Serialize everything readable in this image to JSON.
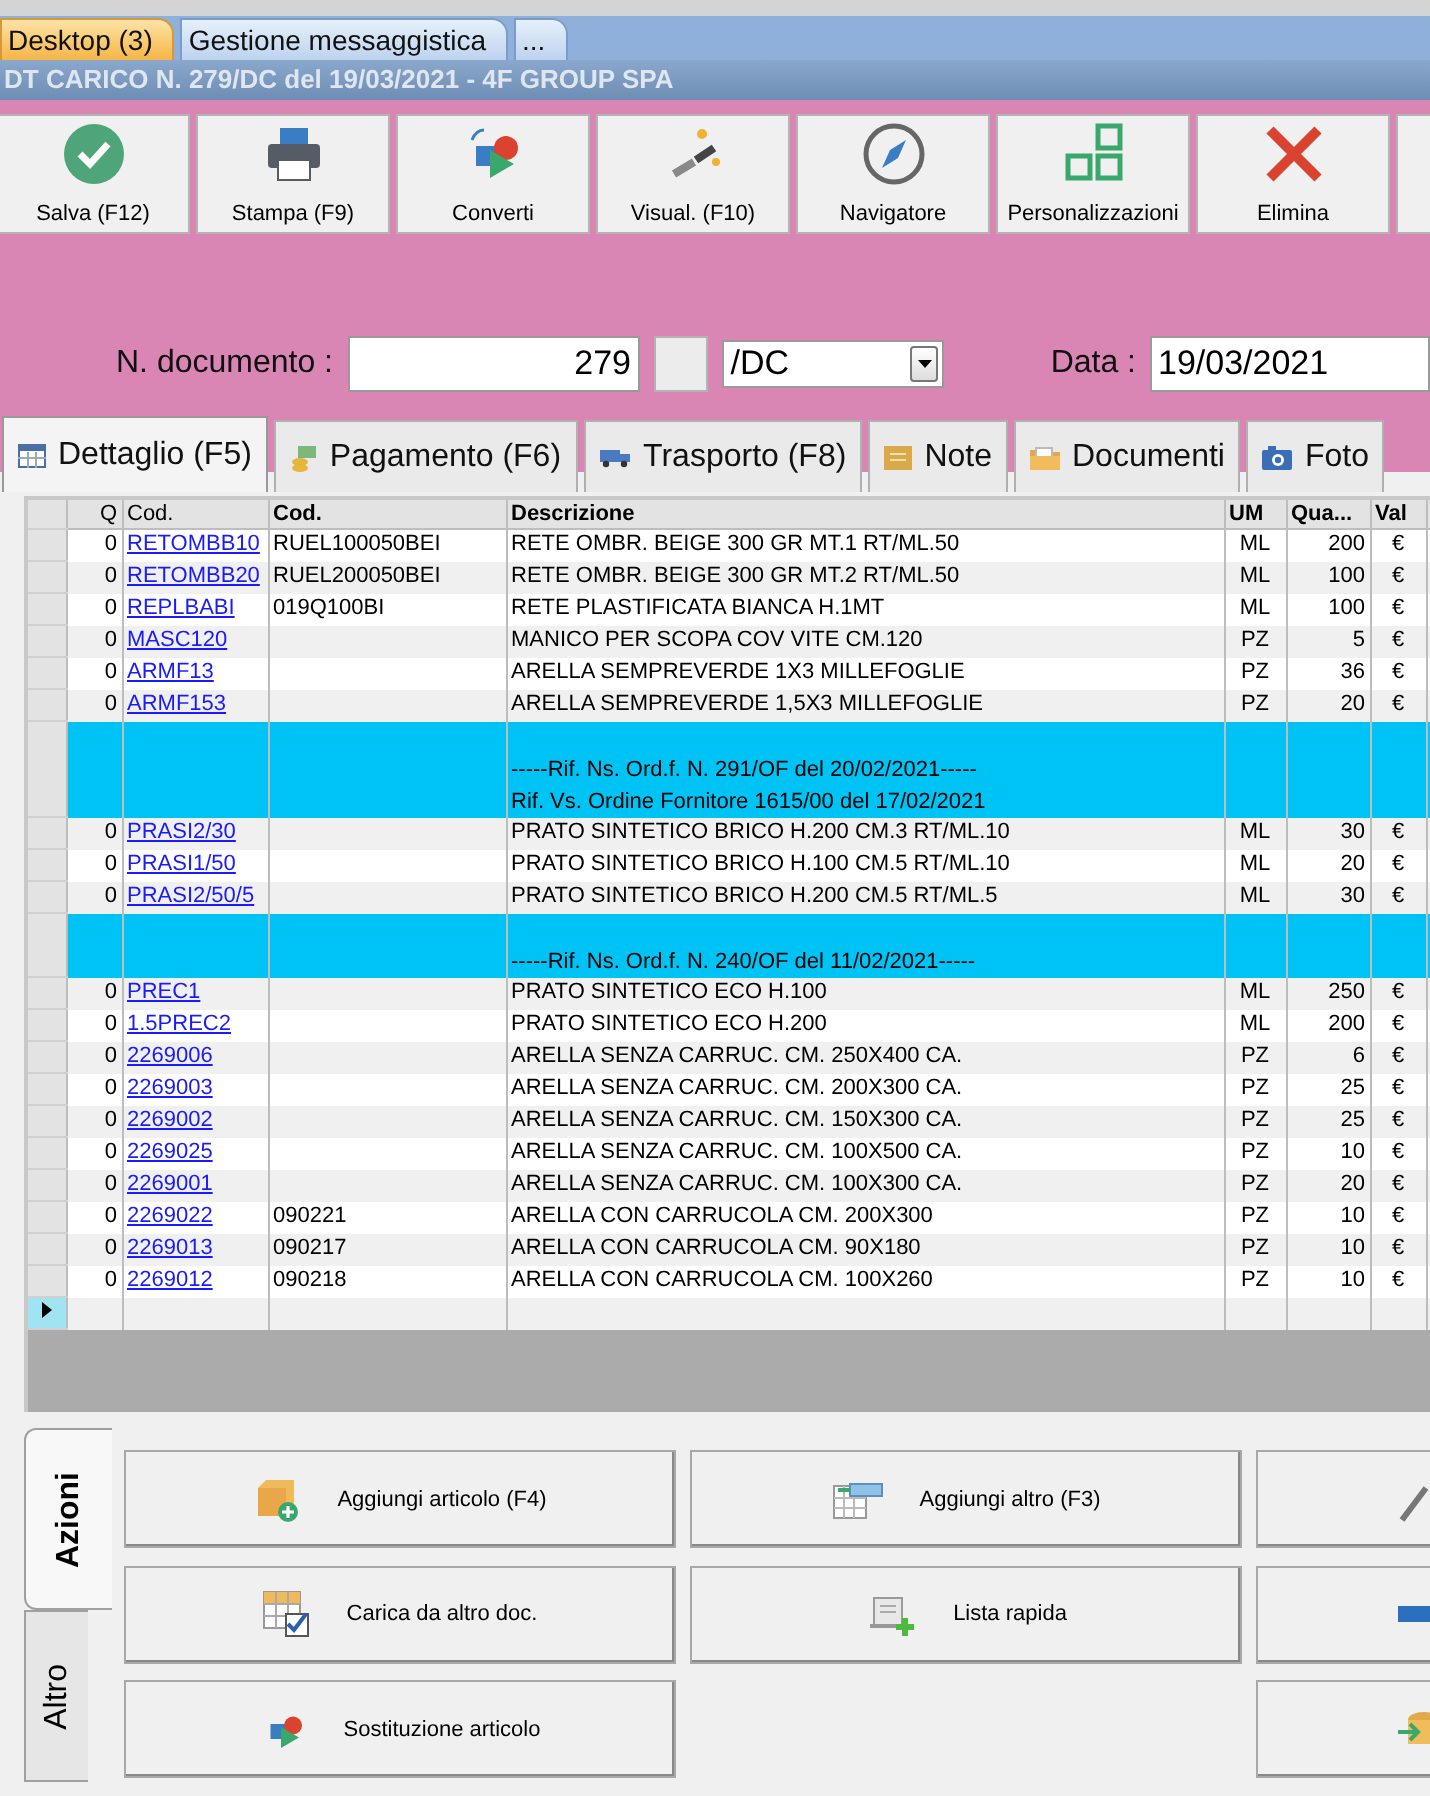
{
  "top_tabs": [
    {
      "label": "Desktop (3)",
      "selected": true
    },
    {
      "label": "Gestione messaggistica",
      "selected": false
    },
    {
      "label": "...",
      "selected": false
    }
  ],
  "document_title": "DT CARICO N. 279/DC del 19/03/2021 - 4F GROUP SPA",
  "toolbar": [
    {
      "label": "Salva (F12)"
    },
    {
      "label": "Stampa (F9)"
    },
    {
      "label": "Converti"
    },
    {
      "label": "Visual. (F10)"
    },
    {
      "label": "Navigatore"
    },
    {
      "label": "Personalizzazioni"
    },
    {
      "label": "Elimina"
    }
  ],
  "form": {
    "doc_label": "N. documento :",
    "doc_number": "279",
    "series": "/DC",
    "date_label": "Data :",
    "date": "19/03/2021"
  },
  "tabs": [
    {
      "label": "Dettaglio (F5)",
      "selected": true
    },
    {
      "label": "Pagamento (F6)",
      "selected": false
    },
    {
      "label": "Trasporto (F8)",
      "selected": false
    },
    {
      "label": "Note",
      "selected": false
    },
    {
      "label": "Documenti",
      "selected": false
    },
    {
      "label": "Foto",
      "selected": false
    }
  ],
  "table": {
    "columns": [
      "Q",
      "Cod.",
      "Cod.",
      "Descrizione",
      "UM",
      "Qua...",
      "Val"
    ],
    "rows": [
      {
        "kind": "item",
        "q": "0",
        "code": "RETOMBB10",
        "supplier_code": "RUEL100050BEI",
        "description": "RETE OMBR. BEIGE 300 GR MT.1 RT/ML.50",
        "um": "ML",
        "quantity": "200",
        "currency": "€"
      },
      {
        "kind": "item",
        "q": "0",
        "code": "RETOMBB20",
        "supplier_code": "RUEL200050BEI",
        "description": "RETE OMBR. BEIGE 300 GR MT.2 RT/ML.50",
        "um": "ML",
        "quantity": "100",
        "currency": "€"
      },
      {
        "kind": "item",
        "q": "0",
        "code": "REPLBABI",
        "supplier_code": "019Q100BI",
        "description": "RETE PLASTIFICATA BIANCA H.1MT",
        "um": "ML",
        "quantity": "100",
        "currency": "€"
      },
      {
        "kind": "item",
        "q": "0",
        "code": "MASC120",
        "description": "MANICO PER SCOPA COV VITE CM.120",
        "um": "PZ",
        "quantity": "5",
        "currency": "€"
      },
      {
        "kind": "item",
        "q": "0",
        "code": "ARMF13",
        "description": "ARELLA SEMPREVERDE 1X3 MILLEFOGLIE",
        "um": "PZ",
        "quantity": "36",
        "currency": "€"
      },
      {
        "kind": "item",
        "q": "0",
        "code": "ARMF153",
        "description": "ARELLA SEMPREVERDE 1,5X3 MILLEFOGLIE",
        "um": "PZ",
        "quantity": "20",
        "currency": "€"
      },
      {
        "kind": "ref",
        "lines": [
          "-----Rif. Ns. Ord.f. N. 291/OF del 20/02/2021-----",
          "Rif. Vs. Ordine Fornitore  1615/00 del 17/02/2021"
        ]
      },
      {
        "kind": "item",
        "q": "0",
        "code": "PRASI2/30",
        "description": "PRATO SINTETICO BRICO H.200 CM.3 RT/ML.10",
        "um": "ML",
        "quantity": "30",
        "currency": "€"
      },
      {
        "kind": "item",
        "q": "0",
        "code": "PRASI1/50",
        "description": "PRATO SINTETICO BRICO H.100 CM.5 RT/ML.10",
        "um": "ML",
        "quantity": "20",
        "currency": "€"
      },
      {
        "kind": "item",
        "q": "0",
        "code": "PRASI2/50/5",
        "description": "PRATO SINTETICO BRICO H.200 CM.5 RT/ML.5",
        "um": "ML",
        "quantity": "30",
        "currency": "€"
      },
      {
        "kind": "ref",
        "lines": [
          "-----Rif. Ns. Ord.f. N. 240/OF del 11/02/2021-----"
        ]
      },
      {
        "kind": "item",
        "q": "0",
        "code": "PREC1",
        "description": "PRATO SINTETICO ECO H.100",
        "um": "ML",
        "quantity": "250",
        "currency": "€"
      },
      {
        "kind": "item",
        "q": "0",
        "code": "1.5PREC2",
        "description": "PRATO SINTETICO ECO H.200",
        "um": "ML",
        "quantity": "200",
        "currency": "€"
      },
      {
        "kind": "item",
        "q": "0",
        "code": "2269006",
        "description": "ARELLA SENZA CARRUC. CM. 250X400 CA.",
        "um": "PZ",
        "quantity": "6",
        "currency": "€"
      },
      {
        "kind": "item",
        "q": "0",
        "code": "2269003",
        "description": "ARELLA SENZA CARRUC. CM. 200X300 CA.",
        "um": "PZ",
        "quantity": "25",
        "currency": "€"
      },
      {
        "kind": "item",
        "q": "0",
        "code": "2269002",
        "description": "ARELLA SENZA CARRUC. CM. 150X300 CA.",
        "um": "PZ",
        "quantity": "25",
        "currency": "€"
      },
      {
        "kind": "item",
        "q": "0",
        "code": "2269025",
        "description": "ARELLA SENZA CARRUC. CM. 100X500 CA.",
        "um": "PZ",
        "quantity": "10",
        "currency": "€"
      },
      {
        "kind": "item",
        "q": "0",
        "code": "2269001",
        "description": "ARELLA SENZA CARRUC. CM. 100X300 CA.",
        "um": "PZ",
        "quantity": "20",
        "currency": "€"
      },
      {
        "kind": "item",
        "q": "0",
        "code": "2269022",
        "supplier_code": "090221",
        "description": "ARELLA CON CARRUCOLA CM. 200X300",
        "um": "PZ",
        "quantity": "10",
        "currency": "€"
      },
      {
        "kind": "item",
        "q": "0",
        "code": "2269013",
        "supplier_code": "090217",
        "description": "ARELLA CON CARRUCOLA CM. 90X180",
        "um": "PZ",
        "quantity": "10",
        "currency": "€"
      },
      {
        "kind": "item",
        "q": "0",
        "code": "2269012",
        "supplier_code": "090218",
        "description": "ARELLA CON CARRUCOLA CM. 100X260",
        "um": "PZ",
        "quantity": "10",
        "currency": "€"
      },
      {
        "kind": "new"
      }
    ]
  },
  "side_tabs": [
    {
      "label": "Azioni",
      "selected": true
    },
    {
      "label": "Altro",
      "selected": false
    }
  ],
  "actions": [
    {
      "kind": "button",
      "label": "Aggiungi articolo (F4)"
    },
    {
      "kind": "button",
      "label": "Aggiungi altro (F3)"
    },
    {
      "kind": "button"
    },
    {
      "kind": "button",
      "label": "Carica da altro doc."
    },
    {
      "kind": "button",
      "label": "Lista rapida"
    },
    {
      "kind": "button"
    },
    {
      "kind": "button",
      "label": "Sostituzione articolo"
    },
    {
      "kind": "gap"
    },
    {
      "kind": "button"
    }
  ]
}
